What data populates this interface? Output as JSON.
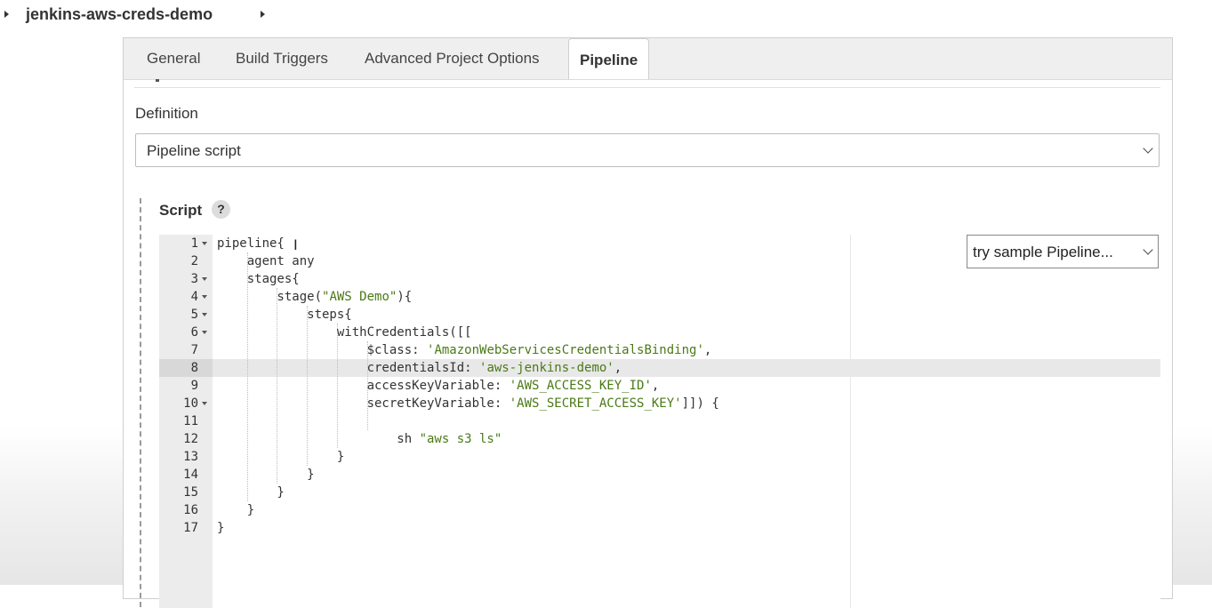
{
  "header": {
    "project_name": "jenkins-aws-creds-demo"
  },
  "tabs": [
    {
      "label": "General",
      "active": false
    },
    {
      "label": "Build Triggers",
      "active": false
    },
    {
      "label": "Advanced Project Options",
      "active": false
    },
    {
      "label": "Pipeline",
      "active": true
    }
  ],
  "definition": {
    "label": "Definition",
    "selected": "Pipeline script"
  },
  "script": {
    "label": "Script",
    "help_symbol": "?",
    "sample_select": "try sample Pipeline...",
    "highlighted_line": 8,
    "lines": [
      {
        "n": "1",
        "parts": [
          {
            "t": "pipeline{"
          }
        ]
      },
      {
        "n": "2",
        "parts": [
          {
            "t": "    agent any"
          }
        ]
      },
      {
        "n": "3",
        "parts": [
          {
            "t": "    stages{"
          }
        ]
      },
      {
        "n": "4",
        "parts": [
          {
            "t": "        stage("
          },
          {
            "t": "\"AWS Demo\"",
            "s": 1
          },
          {
            "t": "){"
          }
        ]
      },
      {
        "n": "5",
        "parts": [
          {
            "t": "            steps{"
          }
        ]
      },
      {
        "n": "6",
        "parts": [
          {
            "t": "                withCredentials([["
          }
        ]
      },
      {
        "n": "7",
        "parts": [
          {
            "t": "                    $class: "
          },
          {
            "t": "'AmazonWebServicesCredentialsBinding'",
            "s": 1
          },
          {
            "t": ","
          }
        ]
      },
      {
        "n": "8",
        "parts": [
          {
            "t": "                    credentialsId: "
          },
          {
            "t": "'aws-jenkins-demo'",
            "s": 1
          },
          {
            "t": ","
          }
        ]
      },
      {
        "n": "9",
        "parts": [
          {
            "t": "                    accessKeyVariable: "
          },
          {
            "t": "'AWS_ACCESS_KEY_ID'",
            "s": 1
          },
          {
            "t": ","
          }
        ]
      },
      {
        "n": "10",
        "parts": [
          {
            "t": "                    secretKeyVariable: "
          },
          {
            "t": "'AWS_SECRET_ACCESS_KEY'",
            "s": 1
          },
          {
            "t": "]]) {"
          }
        ]
      },
      {
        "n": "11",
        "parts": [
          {
            "t": ""
          }
        ]
      },
      {
        "n": "12",
        "parts": [
          {
            "t": "                        sh "
          },
          {
            "t": "\"aws s3 ls\"",
            "s": 1
          }
        ]
      },
      {
        "n": "13",
        "parts": [
          {
            "t": "                }"
          }
        ]
      },
      {
        "n": "14",
        "parts": [
          {
            "t": "            }"
          }
        ]
      },
      {
        "n": "15",
        "parts": [
          {
            "t": "        }"
          }
        ]
      },
      {
        "n": "16",
        "parts": [
          {
            "t": "    }"
          }
        ]
      },
      {
        "n": "17",
        "parts": [
          {
            "t": "}"
          }
        ]
      }
    ],
    "fold_lines": [
      1,
      3,
      4,
      5,
      6,
      10
    ]
  },
  "icons": {
    "breadcrumb_left": "caret-right-icon",
    "breadcrumb_right": "caret-right-icon",
    "select_chevron": "chevron-down-icon",
    "text_cursor": "text-cursor-icon"
  },
  "colors": {
    "string": "#4a7a16",
    "gutter": "#ececec",
    "active_line": "#e8e8e8"
  }
}
